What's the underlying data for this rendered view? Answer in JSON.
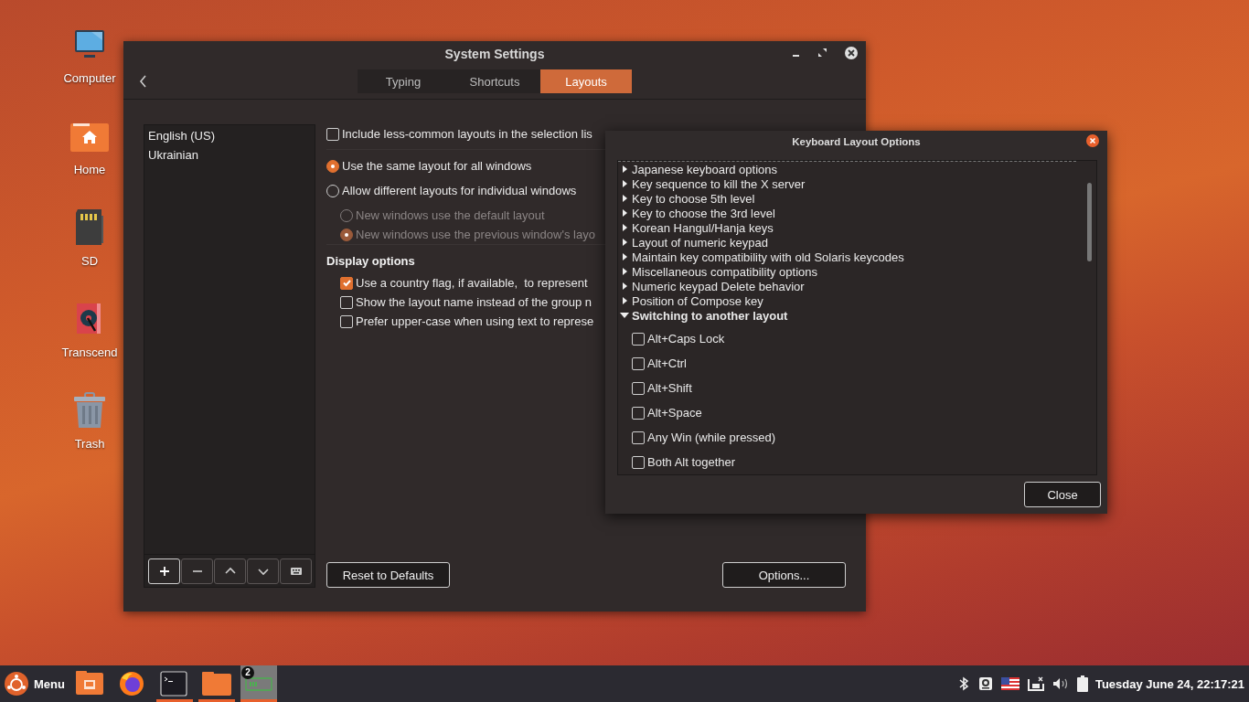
{
  "desktop_icons": [
    {
      "label": "Computer",
      "kind": "computer"
    },
    {
      "label": "Home",
      "kind": "home"
    },
    {
      "label": "SD",
      "kind": "sd"
    },
    {
      "label": "Transcend",
      "kind": "drive"
    },
    {
      "label": "Trash",
      "kind": "trash"
    }
  ],
  "settings_window": {
    "title": "System Settings",
    "tabs": [
      {
        "label": "Typing",
        "selected": false
      },
      {
        "label": "Shortcuts",
        "selected": false
      },
      {
        "label": "Layouts",
        "selected": true
      }
    ],
    "layouts": [
      {
        "label": "English (US)"
      },
      {
        "label": "Ukrainian"
      }
    ],
    "list_buttons": [
      {
        "kind": "add"
      },
      {
        "kind": "remove"
      },
      {
        "kind": "up"
      },
      {
        "kind": "down"
      },
      {
        "kind": "keyboard"
      }
    ],
    "options": [
      {
        "kind": "checkbox",
        "label": "Include less-common layouts in the selection lis",
        "checked": false
      },
      {
        "kind": "separator"
      },
      {
        "kind": "radio",
        "label": "Use the same layout for all windows",
        "selected": true
      },
      {
        "kind": "radio",
        "label": "Allow different layouts for individual windows",
        "selected": false,
        "children": [
          {
            "kind": "radio",
            "label": "New windows use the default layout",
            "selected": false,
            "disabled": true
          },
          {
            "kind": "radio",
            "label": "New windows use the previous window's layo",
            "selected": true,
            "disabled": true
          }
        ]
      },
      {
        "kind": "separator"
      },
      {
        "kind": "heading",
        "label": "Display options",
        "children": [
          {
            "kind": "checkbox",
            "label": "Use a country flag, if available,  to represent",
            "checked": true
          },
          {
            "kind": "checkbox",
            "label": "Show the layout name instead of the group n",
            "checked": false
          },
          {
            "kind": "checkbox",
            "label": "Prefer upper-case when using text to represe",
            "checked": false
          }
        ]
      }
    ],
    "buttons": [
      {
        "label": "Reset to Defaults"
      },
      {
        "label": "Options..."
      }
    ]
  },
  "options_dialog": {
    "title": "Keyboard Layout Options",
    "groups": [
      {
        "label": "Japanese keyboard options",
        "expanded": false
      },
      {
        "label": "Key sequence to kill the X server",
        "expanded": false
      },
      {
        "label": "Key to choose 5th level",
        "expanded": false
      },
      {
        "label": "Key to choose the 3rd level",
        "expanded": false
      },
      {
        "label": "Korean Hangul/Hanja keys",
        "expanded": false
      },
      {
        "label": "Layout of numeric keypad",
        "expanded": false
      },
      {
        "label": "Maintain key compatibility with old Solaris keycodes",
        "expanded": false
      },
      {
        "label": "Miscellaneous compatibility options",
        "expanded": false
      },
      {
        "label": "Numeric keypad Delete behavior",
        "expanded": false
      },
      {
        "label": "Position of Compose key",
        "expanded": false
      },
      {
        "label": "Switching to another layout",
        "expanded": true,
        "children": [
          {
            "label": "Alt+Caps Lock",
            "checked": false
          },
          {
            "label": "Alt+Ctrl",
            "checked": false
          },
          {
            "label": "Alt+Shift",
            "checked": false
          },
          {
            "label": "Alt+Space",
            "checked": false
          },
          {
            "label": "Any Win (while pressed)",
            "checked": false
          },
          {
            "label": "Both Alt together",
            "checked": false
          }
        ]
      }
    ],
    "close_button": "Close"
  },
  "taskbar": {
    "menu_label": "Menu",
    "apps": [
      {
        "kind": "presentation",
        "running": false,
        "active": false
      },
      {
        "kind": "browser",
        "running": false,
        "active": false
      },
      {
        "kind": "terminal",
        "running": true,
        "active": false
      },
      {
        "kind": "files",
        "running": true,
        "active": false
      },
      {
        "kind": "battery-monitor",
        "running": true,
        "active": true,
        "badge": "2"
      }
    ],
    "clock": "Tuesday June 24, 22:17:21"
  }
}
